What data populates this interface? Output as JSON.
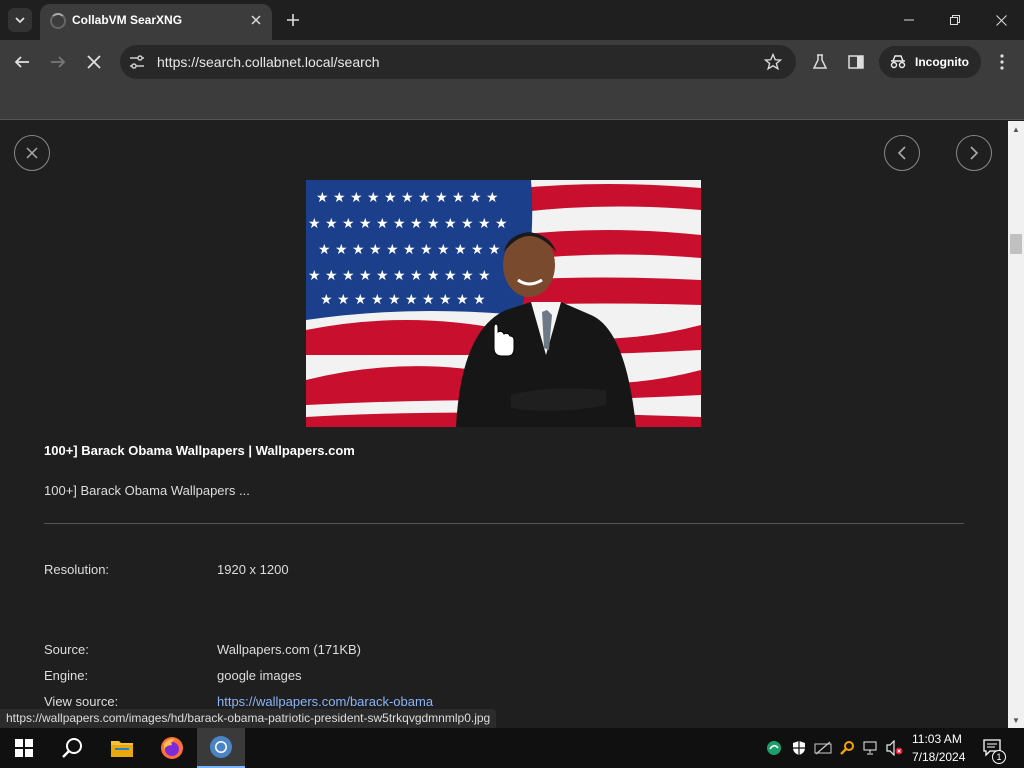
{
  "browser": {
    "tab_title": "CollabVM SearXNG",
    "url": "https://search.collabnet.local/search",
    "incognito_label": "Incognito",
    "status_url": "https://wallpapers.com/images/hd/barack-obama-patriotic-president-sw5trkqvgdmnmlp0.jpg"
  },
  "result": {
    "title": "100+] Barack Obama Wallpapers | Wallpapers.com",
    "description": "100+] Barack Obama Wallpapers ...",
    "resolution_label": "Resolution:",
    "resolution_value": "1920 x 1200",
    "source_label": "Source:",
    "source_value": "Wallpapers.com (171KB)",
    "engine_label": "Engine:",
    "engine_value": "google images",
    "view_source_label": "View source:",
    "view_source_value": "https://wallpapers.com/barack-obama"
  },
  "taskbar": {
    "time": "11:03 AM",
    "date": "7/18/2024",
    "notification_count": "1"
  },
  "colors": {
    "link": "#8ab4f8",
    "background": "#1f1f1f",
    "toolbar": "#3c3c3c"
  }
}
